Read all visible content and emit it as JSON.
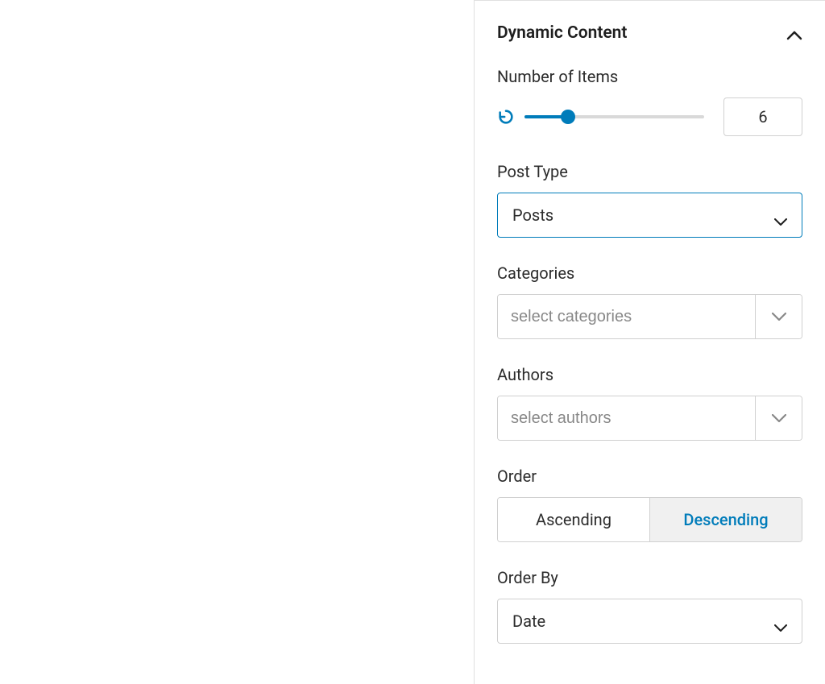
{
  "panel": {
    "title": "Dynamic Content"
  },
  "numberOfItems": {
    "label": "Number of Items",
    "value": "6"
  },
  "postType": {
    "label": "Post Type",
    "value": "Posts"
  },
  "categories": {
    "label": "Categories",
    "placeholder": "select categories"
  },
  "authors": {
    "label": "Authors",
    "placeholder": "select authors"
  },
  "order": {
    "label": "Order",
    "options": {
      "ascending": "Ascending",
      "descending": "Descending"
    },
    "selected": "descending"
  },
  "orderBy": {
    "label": "Order By",
    "value": "Date"
  }
}
